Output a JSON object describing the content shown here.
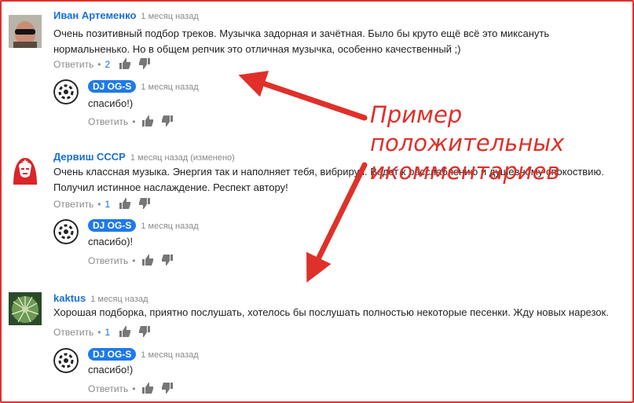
{
  "comments": [
    {
      "author": "Иван Артеменко",
      "time": "1 месяц назад",
      "text_lines": [
        "Очень позитивный подбор треков. Музычка задорная и зачётная. Было бы круто ещё всё это миксануть",
        "нормальненько. Но в общем репчик это отличная музычка, особенно качественный ;)"
      ],
      "reply_label": "Ответить",
      "likes": "2",
      "reply": {
        "author": "DJ OG-S",
        "time": "1 месяц назад",
        "text": "спасибо!)",
        "reply_label": "Ответить"
      }
    },
    {
      "author": "Дервиш СССР",
      "time": "1 месяц назад (изменено)",
      "text_lines": [
        "Очень классная музыка. Энергия так и наполняет тебя, вибрируя. Ведет к расслаблению и душевному спокоствию.",
        "Получил истинное наслаждение.  Респект автору!"
      ],
      "reply_label": "Ответить",
      "likes": "1",
      "reply": {
        "author": "DJ OG-S",
        "time": "1 месяц назад",
        "text": "спасибо)!",
        "reply_label": "Ответить"
      }
    },
    {
      "author": "kaktus",
      "time": "1 месяц назад",
      "text_lines": [
        "Хорошая подборка, приятно послушать, хотелось бы послушать полностью некоторые песенки. Жду новых нарезок."
      ],
      "reply_label": "Ответить",
      "likes": "1",
      "reply": {
        "author": "DJ OG-S",
        "time": "1 месяц назад",
        "text": "спасибо!)",
        "reply_label": "Ответить"
      }
    }
  ],
  "annotation": {
    "line1": "Пример положительных",
    "line2": "икомментариев"
  },
  "dot": "•",
  "colors": {
    "accent": "#e0302a",
    "link": "#1a6fd2",
    "badge": "#1f7ae8"
  }
}
